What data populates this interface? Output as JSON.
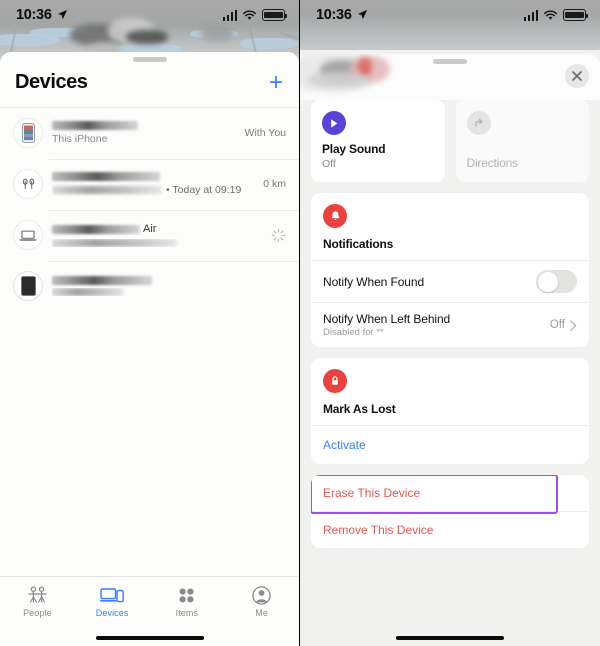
{
  "status_bar": {
    "time": "10:36",
    "location_icon": "location-arrow-icon",
    "signal_icon": "cellular-signal-icon",
    "wifi_icon": "wifi-icon",
    "battery_icon": "battery-icon"
  },
  "left_panel": {
    "header": {
      "title": "Devices",
      "add_label": "+"
    },
    "devices": [
      {
        "icon": "iphone-icon",
        "name": "",
        "subtitle": "This iPhone",
        "status": "With You",
        "has_spinner": false
      },
      {
        "icon": "airpods-icon",
        "name": "",
        "subtitle_suffix": "• Today at 09:19",
        "status": "0 km",
        "has_spinner": false
      },
      {
        "icon": "macbook-icon",
        "name": "Air",
        "subtitle": "",
        "status": "",
        "has_spinner": true
      },
      {
        "icon": "ipad-icon",
        "name": "",
        "subtitle": "",
        "status": "",
        "has_spinner": false
      }
    ],
    "tabs": [
      {
        "label": "People",
        "icon": "people-icon",
        "active": false
      },
      {
        "label": "Devices",
        "icon": "devices-icon",
        "active": true
      },
      {
        "label": "Items",
        "icon": "items-icon",
        "active": false
      },
      {
        "label": "Me",
        "icon": "person-circle-icon",
        "active": false
      }
    ]
  },
  "right_panel": {
    "close_label": "close-icon",
    "play_sound": {
      "title": "Play Sound",
      "subtitle": "Off",
      "icon": "play-icon"
    },
    "directions": {
      "title": "Directions",
      "icon": "directions-arrow-icon"
    },
    "notifications": {
      "title": "Notifications",
      "icon": "bell-icon",
      "notify_when_found": {
        "label": "Notify When Found",
        "toggle_on": false
      },
      "notify_when_left_behind": {
        "label": "Notify When Left Behind",
        "sublabel": "Disabled for **",
        "value": "Off",
        "chevron": "chevron-right-icon"
      }
    },
    "mark_as_lost": {
      "title": "Mark As Lost",
      "icon": "lock-icon",
      "activate_label": "Activate"
    },
    "danger_actions": [
      {
        "label": "Erase This Device",
        "highlighted": true
      },
      {
        "label": "Remove This Device",
        "highlighted": false
      }
    ]
  },
  "colors": {
    "accent_blue": "#3a7dfb",
    "purple_icon": "#5b43d6",
    "red_icon": "#e8433f",
    "danger_text": "#e05b52",
    "highlight_box": "#a04fe0"
  }
}
